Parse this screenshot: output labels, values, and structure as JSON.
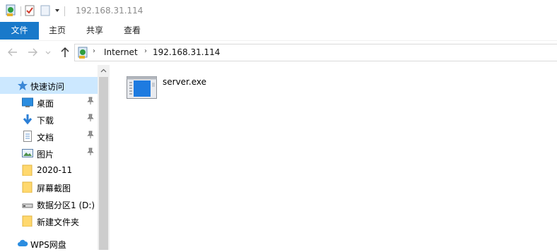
{
  "window": {
    "title": "192.168.31.114"
  },
  "ribbon": {
    "tabs": [
      "文件",
      "主页",
      "共享",
      "查看"
    ]
  },
  "address": {
    "crumbs": [
      "Internet",
      "192.168.31.114"
    ]
  },
  "sidebar": {
    "items": [
      {
        "label": "快速访问",
        "icon": "star-icon",
        "selected": true,
        "pinned": false
      },
      {
        "label": "桌面",
        "icon": "desktop-icon",
        "selected": false,
        "pinned": true
      },
      {
        "label": "下载",
        "icon": "download-icon",
        "selected": false,
        "pinned": true
      },
      {
        "label": "文档",
        "icon": "document-icon",
        "selected": false,
        "pinned": true
      },
      {
        "label": "图片",
        "icon": "pictures-icon",
        "selected": false,
        "pinned": true
      },
      {
        "label": "2020-11",
        "icon": "folder-icon",
        "selected": false,
        "pinned": false
      },
      {
        "label": "屏幕截图",
        "icon": "folder-icon",
        "selected": false,
        "pinned": false
      },
      {
        "label": "数据分区1 (D:)",
        "icon": "drive-icon",
        "selected": false,
        "pinned": false
      },
      {
        "label": "新建文件夹",
        "icon": "folder-icon",
        "selected": false,
        "pinned": false
      },
      {
        "label": "WPS网盘",
        "icon": "cloud-icon",
        "selected": false,
        "pinned": false
      }
    ]
  },
  "content": {
    "files": [
      {
        "name": "server.exe",
        "icon": "executable-icon"
      }
    ]
  },
  "colors": {
    "accent": "#1979ca",
    "selection": "#cce8ff",
    "folder": "#ffd86e"
  }
}
